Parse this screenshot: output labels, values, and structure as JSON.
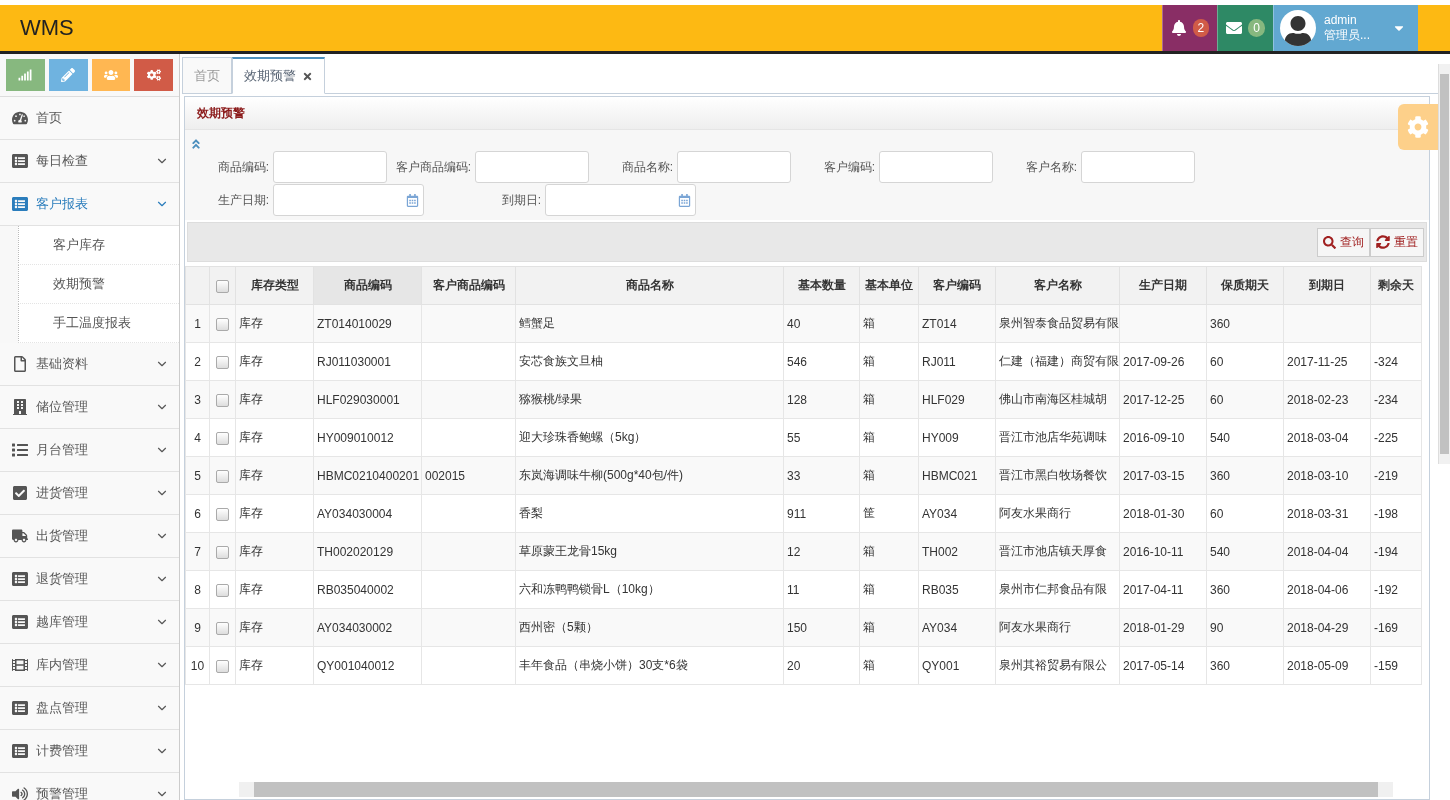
{
  "header": {
    "title": "WMS",
    "notifications": {
      "count": "2"
    },
    "messages": {
      "count": "0"
    },
    "user": {
      "name": "admin",
      "role": "管理员..."
    }
  },
  "sidebar": {
    "shortcuts": [
      {
        "color": "#87b87f"
      },
      {
        "color": "#6fb3e0"
      },
      {
        "color": "#ffb752"
      },
      {
        "color": "#d15b47"
      }
    ],
    "items": [
      {
        "label": "首页",
        "kind": "link",
        "expanded": false
      },
      {
        "label": "每日检查",
        "kind": "group",
        "expanded": false
      },
      {
        "label": "客户报表",
        "kind": "group",
        "expanded": true,
        "children": [
          {
            "label": "客户库存"
          },
          {
            "label": "效期预警"
          },
          {
            "label": "手工温度报表"
          }
        ]
      },
      {
        "label": "基础资料",
        "kind": "group",
        "expanded": false
      },
      {
        "label": "储位管理",
        "kind": "group",
        "expanded": false
      },
      {
        "label": "月台管理",
        "kind": "group",
        "expanded": false
      },
      {
        "label": "进货管理",
        "kind": "group",
        "expanded": false
      },
      {
        "label": "出货管理",
        "kind": "group",
        "expanded": false
      },
      {
        "label": "退货管理",
        "kind": "group",
        "expanded": false
      },
      {
        "label": "越库管理",
        "kind": "group",
        "expanded": false
      },
      {
        "label": "库内管理",
        "kind": "group",
        "expanded": false
      },
      {
        "label": "盘点管理",
        "kind": "group",
        "expanded": false
      },
      {
        "label": "计费管理",
        "kind": "group",
        "expanded": false
      },
      {
        "label": "预警管理",
        "kind": "group",
        "expanded": false
      }
    ]
  },
  "tabs": [
    {
      "label": "首页",
      "selected": false,
      "closable": false
    },
    {
      "label": "效期预警",
      "selected": true,
      "closable": true
    }
  ],
  "panel": {
    "title": "效期预警",
    "filters": [
      [
        {
          "label": "商品编码:",
          "kind": "text"
        },
        {
          "label": "客户商品编码:",
          "kind": "text"
        },
        {
          "label": "商品名称:",
          "kind": "text"
        },
        {
          "label": "客户编码:",
          "kind": "text"
        },
        {
          "label": "客户名称:",
          "kind": "text"
        }
      ],
      [
        {
          "label": "生产日期:",
          "kind": "date"
        },
        {
          "label": "到期日:",
          "kind": "date"
        }
      ]
    ],
    "buttons": [
      {
        "label": "查询",
        "kind": "search"
      },
      {
        "label": "重置",
        "kind": "reset"
      }
    ],
    "table": {
      "all_checked": false,
      "columns": [
        "库存类型",
        "商品编码",
        "客户商品编码",
        "商品名称",
        "基本数量",
        "基本单位",
        "客户编码",
        "客户名称",
        "生产日期",
        "保质期天",
        "到期日",
        "剩余天"
      ],
      "rows": [
        {
          "no": "1",
          "checked": false,
          "cells": [
            "库存",
            "ZT014010029",
            "",
            "鳕蟹足",
            "40",
            "箱",
            "ZT014",
            "泉州智泰食品贸易有限",
            "",
            "360",
            "",
            ""
          ]
        },
        {
          "no": "2",
          "checked": false,
          "cells": [
            "库存",
            "RJ011030001",
            "",
            "安芯食族文旦柚",
            "546",
            "箱",
            "RJ011",
            "仁建（福建）商贸有限",
            "2017-09-26",
            "60",
            "2017-11-25",
            "-324"
          ]
        },
        {
          "no": "3",
          "checked": false,
          "cells": [
            "库存",
            "HLF029030001",
            "",
            "猕猴桃/绿果",
            "128",
            "箱",
            "HLF029",
            "佛山市南海区桂城胡",
            "2017-12-25",
            "60",
            "2018-02-23",
            "-234"
          ]
        },
        {
          "no": "4",
          "checked": false,
          "cells": [
            "库存",
            "HY009010012",
            "",
            "迎大珍珠香鲍螺（5kg）",
            "55",
            "箱",
            "HY009",
            "晋江市池店华苑调味",
            "2016-09-10",
            "540",
            "2018-03-04",
            "-225"
          ]
        },
        {
          "no": "5",
          "checked": false,
          "cells": [
            "库存",
            "HBMC0210400201",
            "002015",
            "东岚海调味牛柳(500g*40包/件)",
            "33",
            "箱",
            "HBMC021",
            "晋江市黑白牧场餐饮",
            "2017-03-15",
            "360",
            "2018-03-10",
            "-219"
          ]
        },
        {
          "no": "6",
          "checked": false,
          "cells": [
            "库存",
            "AY034030004",
            "",
            "香梨",
            "911",
            "筐",
            "AY034",
            "阿友水果商行",
            "2018-01-30",
            "60",
            "2018-03-31",
            "-198"
          ]
        },
        {
          "no": "7",
          "checked": false,
          "cells": [
            "库存",
            "TH002020129",
            "",
            "草原蒙王龙骨15kg",
            "12",
            "箱",
            "TH002",
            "晋江市池店镇天厚食",
            "2016-10-11",
            "540",
            "2018-04-04",
            "-194"
          ]
        },
        {
          "no": "8",
          "checked": false,
          "cells": [
            "库存",
            "RB035040002",
            "",
            "六和冻鸭鸭锁骨L（10kg）",
            "11",
            "箱",
            "RB035",
            "泉州市仁邦食品有限",
            "2017-04-11",
            "360",
            "2018-04-06",
            "-192"
          ]
        },
        {
          "no": "9",
          "checked": false,
          "cells": [
            "库存",
            "AY034030002",
            "",
            "西州密（5颗）",
            "150",
            "箱",
            "AY034",
            "阿友水果商行",
            "2018-01-29",
            "90",
            "2018-04-29",
            "-169"
          ]
        },
        {
          "no": "10",
          "checked": false,
          "cells": [
            "库存",
            "QY001040012",
            "",
            "丰年食品（串烧小饼）30支*6袋",
            "20",
            "箱",
            "QY001",
            "泉州其裕贸易有限公",
            "2017-05-14",
            "360",
            "2018-05-09",
            "-159"
          ]
        }
      ]
    }
  }
}
